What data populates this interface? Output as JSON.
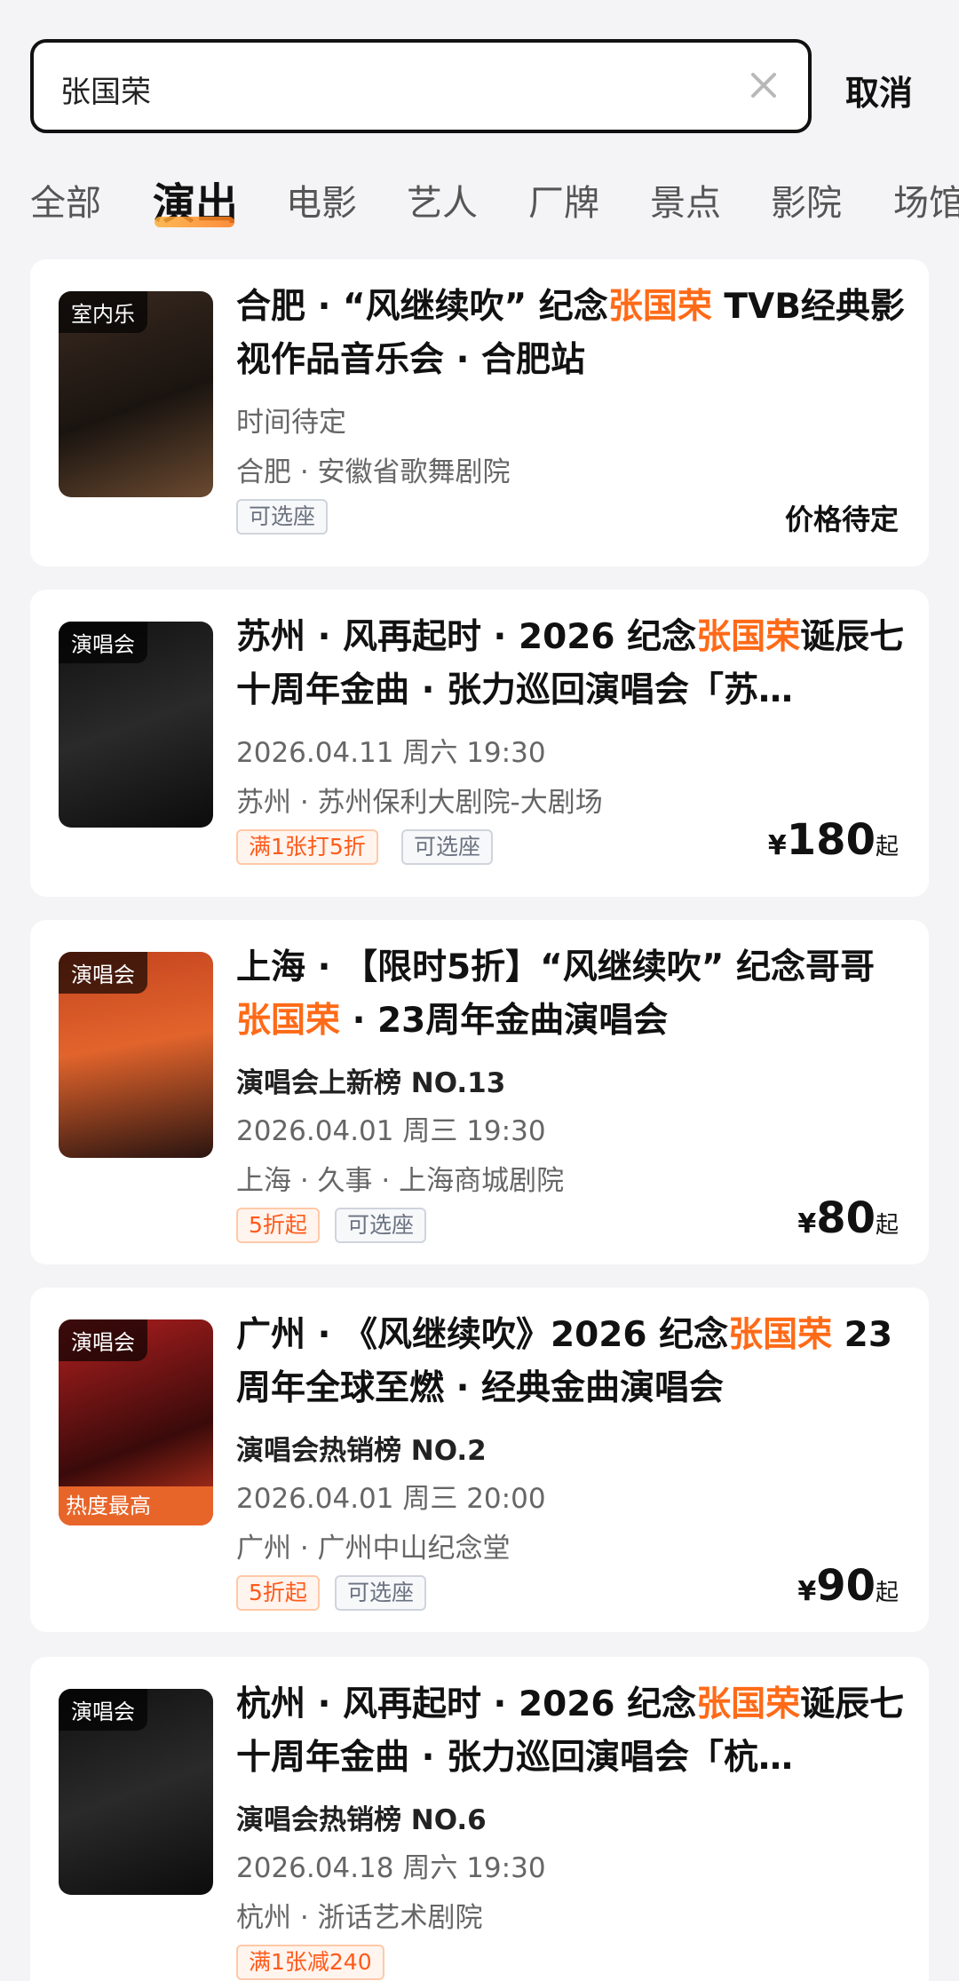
{
  "search": {
    "query": "张国荣",
    "cancel_label": "取消"
  },
  "tabs": [
    "全部",
    "演出",
    "电影",
    "艺人",
    "厂牌",
    "景点",
    "影院",
    "场馆"
  ],
  "active_tab_index": 1,
  "colors": {
    "accent": "#ff6a17",
    "tab_underline": "#ff9a2a"
  },
  "results": [
    {
      "poster_tag": "室内乐",
      "title_pre": "合肥 · “风继续吹” 纪念",
      "title_highlight": "张国荣",
      "title_post": " TVB经典影视作品音乐会 · 合肥站",
      "rank": "",
      "time": "时间待定",
      "venue": "合肥 · 安徽省歌舞剧院",
      "chips": [
        {
          "label": "可选座",
          "type": "normal"
        }
      ],
      "price_tbd": "价格待定"
    },
    {
      "poster_tag": "演唱会",
      "title_pre": "苏州 · 风再起时 · 2026 纪念",
      "title_highlight": "张国荣",
      "title_post": "诞辰七十周年金曲 · 张力巡回演唱会「苏…",
      "rank": "",
      "time": "2026.04.11 周六 19:30",
      "venue": "苏州 · 苏州保利大剧院-大剧场",
      "chips": [
        {
          "label": "满1张打5折",
          "type": "promo"
        },
        {
          "label": "可选座",
          "type": "normal"
        }
      ],
      "price": {
        "currency": "¥",
        "amount": "180",
        "suffix": "起"
      }
    },
    {
      "poster_tag": "演唱会",
      "title_pre": "上海 · 【限时5折】“风继续吹” 纪念哥哥",
      "title_highlight": "张国荣",
      "title_post": " · 23周年金曲演唱会",
      "rank": "演唱会上新榜 NO.13",
      "time": "2026.04.01 周三 19:30",
      "venue": "上海 · 久事 · 上海商城剧院",
      "chips": [
        {
          "label": "5折起",
          "type": "promo"
        },
        {
          "label": "可选座",
          "type": "normal"
        }
      ],
      "price": {
        "currency": "¥",
        "amount": "80",
        "suffix": "起"
      }
    },
    {
      "poster_tag": "演唱会",
      "poster_hot": "热度最高",
      "title_pre": "广州 · 《风继续吹》2026 纪念",
      "title_highlight": "张国荣",
      "title_post": " 23周年全球至燃 · 经典金曲演唱会",
      "rank": "演唱会热销榜 NO.2",
      "time": "2026.04.01 周三 20:00",
      "venue": "广州 · 广州中山纪念堂",
      "chips": [
        {
          "label": "5折起",
          "type": "promo"
        },
        {
          "label": "可选座",
          "type": "normal"
        }
      ],
      "price": {
        "currency": "¥",
        "amount": "90",
        "suffix": "起"
      }
    },
    {
      "poster_tag": "演唱会",
      "title_pre": "杭州 · 风再起时 · 2026 纪念",
      "title_highlight": "张国荣",
      "title_post": "诞辰七十周年金曲 · 张力巡回演唱会「杭…",
      "rank": "演唱会热销榜 NO.6",
      "time": "2026.04.18 周六 19:30",
      "venue": "杭州 · 浙话艺术剧院",
      "chips": [
        {
          "label": "满1张减240",
          "type": "promo"
        }
      ]
    }
  ]
}
